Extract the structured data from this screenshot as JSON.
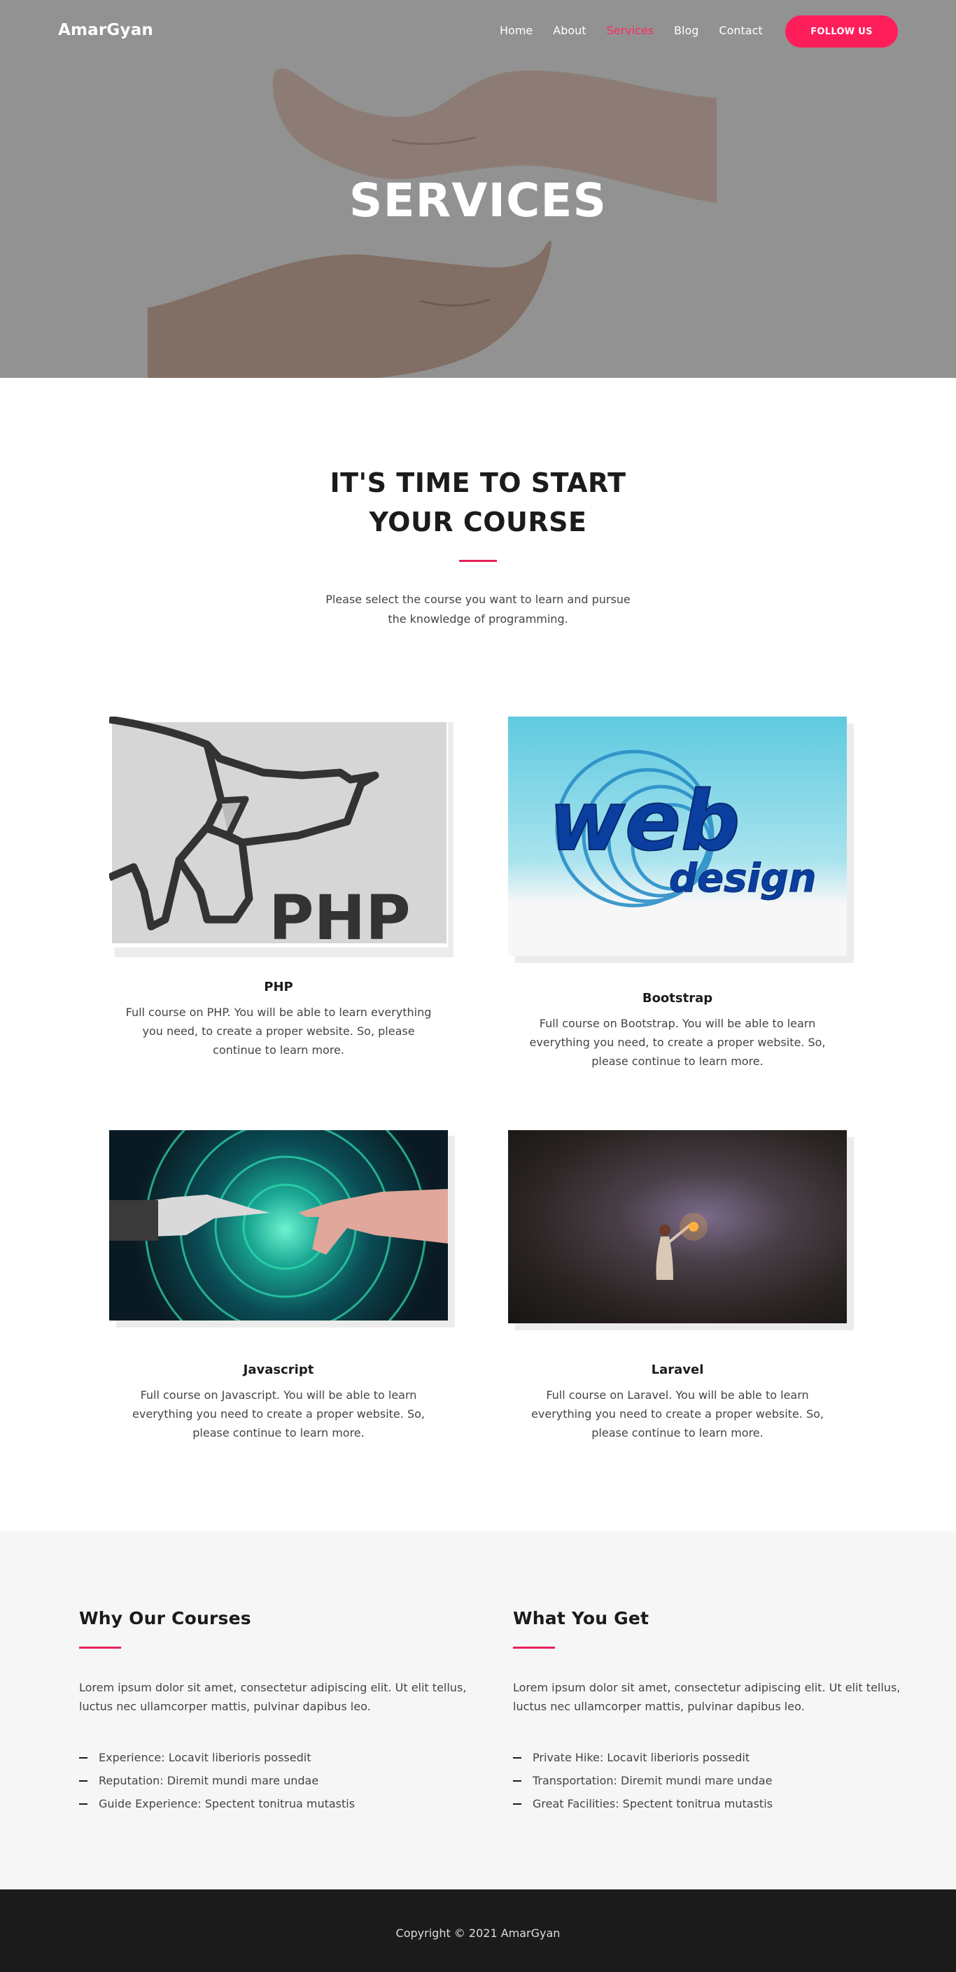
{
  "nav": {
    "brand": "AmarGyan",
    "links": [
      "Home",
      "About",
      "Services",
      "Blog",
      "Contact"
    ],
    "active_index": 2,
    "follow_label": "FOLLOW US"
  },
  "hero": {
    "title": "SERVICES"
  },
  "intro": {
    "heading": "IT'S TIME TO START YOUR COURSE",
    "text": "Please select the course you want to learn and pursue the knowledge of programming."
  },
  "courses": [
    {
      "title": "PHP",
      "logo_text": "PHP",
      "description": "Full course on PHP. You will be able to learn everything you need, to create a proper website. So, please continue to learn more."
    },
    {
      "title": "Bootstrap",
      "logo_text": "web",
      "logo_subtext": "design",
      "description": "Full course on Bootstrap. You will be able to learn everything you need, to create a proper website. So, please continue to learn more."
    },
    {
      "title": "Javascript",
      "description": "Full course on Javascript. You will be able to learn everything you need to create a proper website. So, please continue to learn more."
    },
    {
      "title": "Laravel",
      "description": "Full course on Laravel. You will be able to learn everything you need to create a proper website. So, please continue to learn more."
    }
  ],
  "features": {
    "left": {
      "title": "Why Our Courses",
      "text": "Lorem ipsum dolor sit amet, consectetur adipiscing elit. Ut elit tellus, luctus nec ullamcorper mattis, pulvinar dapibus leo.",
      "items": [
        "Experience: Locavit liberioris possedit",
        "Reputation: Diremit mundi mare undae",
        "Guide Experience: Spectent tonitrua mutastis"
      ]
    },
    "right": {
      "title": "What You Get",
      "text": "Lorem ipsum dolor sit amet, consectetur adipiscing elit. Ut elit tellus, luctus nec ullamcorper mattis, pulvinar dapibus leo.",
      "items": [
        "Private Hike: Locavit liberioris possedit",
        "Transportation: Diremit mundi mare undae",
        "Great Facilities: Spectent tonitrua mutastis"
      ]
    }
  },
  "footer": {
    "copyright": "Copyright © 2021 AmarGyan"
  },
  "colors": {
    "accent": "#ff1e5a",
    "hero_overlay": "#929292",
    "footer_bg": "#1b1b1b",
    "features_bg": "#f6f6f6"
  }
}
